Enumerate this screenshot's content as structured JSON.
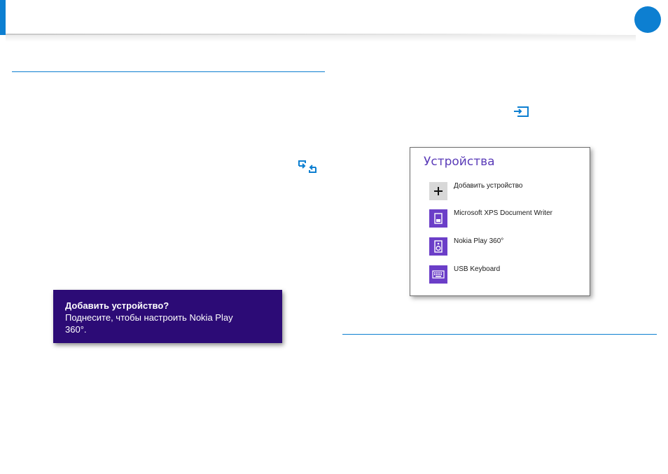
{
  "header": {
    "accent_color": "#0d7fd1"
  },
  "icons": {
    "page_marker": "page-marker-icon",
    "share_devices": "connect-devices-icon",
    "devices_charm": "devices-charm-icon"
  },
  "toast": {
    "title": "Добавить устройство?",
    "body": "Поднесите, чтобы настроить Nokia Play 360°.",
    "background": "#2c0b76"
  },
  "devices_panel": {
    "title": "Устройства",
    "title_color": "#5a3bb8",
    "items": [
      {
        "label": "Добавить устройство",
        "icon": "plus-icon"
      },
      {
        "label": "Microsoft XPS Document Writer",
        "icon": "printer-icon"
      },
      {
        "label": "Nokia Play 360°",
        "icon": "speaker-icon"
      },
      {
        "label": "USB Keyboard",
        "icon": "keyboard-icon"
      }
    ],
    "tile_color": "#6b3ec8"
  }
}
